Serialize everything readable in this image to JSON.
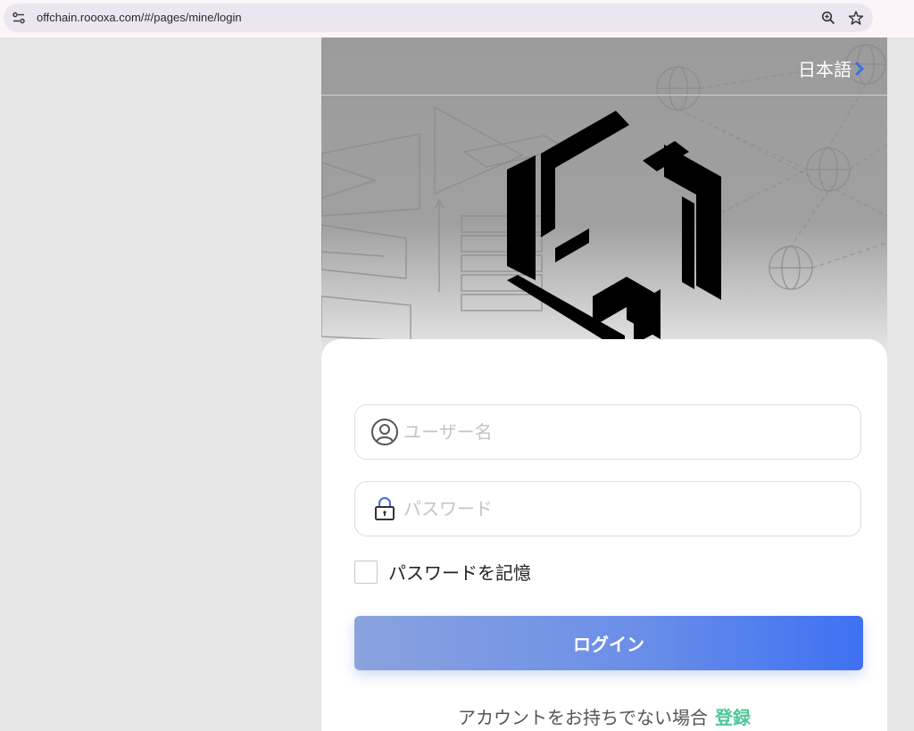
{
  "browser": {
    "url": "offchain.roooxa.com/#/pages/mine/login",
    "icons": [
      "site-settings-icon",
      "zoom-icon",
      "bookmark-star-icon"
    ]
  },
  "header": {
    "language_label": "日本語"
  },
  "form": {
    "username_placeholder": "ユーザー名",
    "password_placeholder": "パスワード",
    "remember_label": "パスワードを記憶",
    "remember_checked": false,
    "login_label": "ログイン"
  },
  "footer": {
    "no_account_text": "アカウントをお持ちでない場合",
    "register_label": "登録"
  },
  "colors": {
    "accent_start": "#8aa2de",
    "accent_end": "#3e70f2",
    "register_link": "#4ec79a"
  }
}
